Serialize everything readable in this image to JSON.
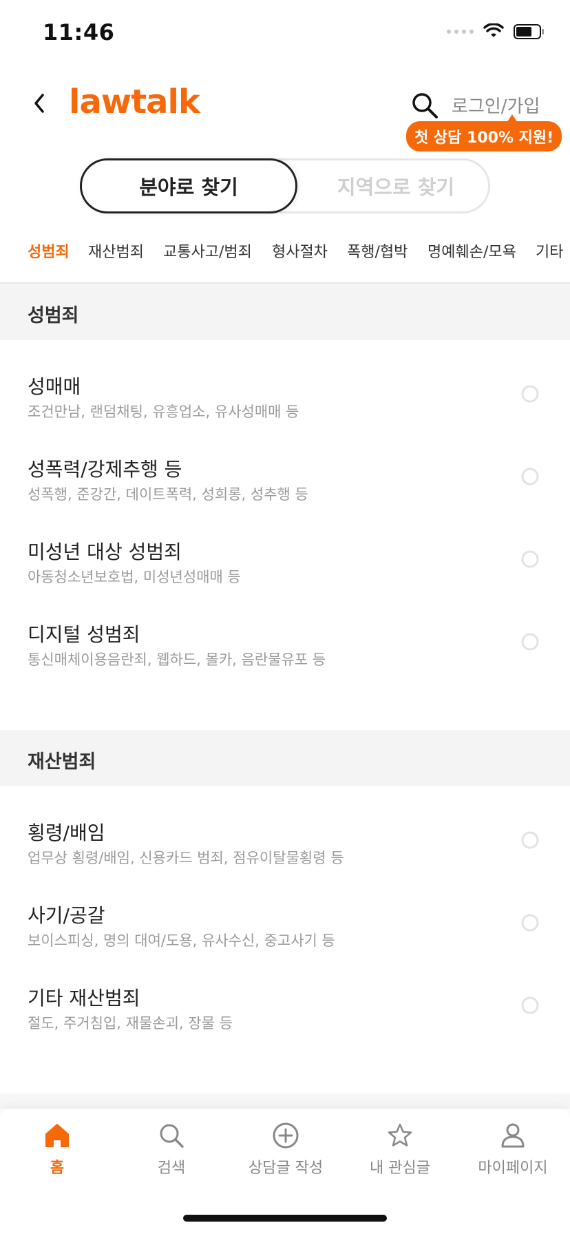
{
  "status_bar": {
    "time": "11:46"
  },
  "header": {
    "logo": "lawtalk",
    "login_label": "로그인/가입",
    "promo_badge": "첫 상담 100% 지원!"
  },
  "segment": {
    "active_label": "분야로 찾기",
    "inactive_label": "지역으로 찾기"
  },
  "category_tabs": [
    {
      "label": "성범죄",
      "active": true
    },
    {
      "label": "재산범죄"
    },
    {
      "label": "교통사고/범죄"
    },
    {
      "label": "형사절차"
    },
    {
      "label": "폭행/협박"
    },
    {
      "label": "명예훼손/모욕"
    },
    {
      "label": "기타"
    }
  ],
  "sections": [
    {
      "title": "성범죄",
      "items": [
        {
          "title": "성매매",
          "desc": "조건만남, 랜덤채팅, 유흥업소, 유사성매매 등"
        },
        {
          "title": "성폭력/강제추행 등",
          "desc": "성폭행, 준강간, 데이트폭력, 성희롱, 성추행 등"
        },
        {
          "title": "미성년 대상 성범죄",
          "desc": "아동청소년보호법, 미성년성매매 등"
        },
        {
          "title": "디지털 성범죄",
          "desc": "통신매체이용음란죄, 웹하드, 몰카, 음란물유포 등"
        }
      ]
    },
    {
      "title": "재산범죄",
      "items": [
        {
          "title": "횡령/배임",
          "desc": "업무상 횡령/배임, 신용카드 범죄, 점유이탈물횡령 등"
        },
        {
          "title": "사기/공갈",
          "desc": "보이스피싱, 명의 대여/도용, 유사수신, 중고사기 등"
        },
        {
          "title": "기타 재산범죄",
          "desc": "절도, 주거침입, 재물손괴, 장물 등"
        }
      ]
    }
  ],
  "bottom_nav": [
    {
      "label": "홈",
      "icon": "home-icon",
      "active": true
    },
    {
      "label": "검색",
      "icon": "search-icon"
    },
    {
      "label": "상담글 작성",
      "icon": "plus-circle-icon"
    },
    {
      "label": "내 관심글",
      "icon": "star-icon"
    },
    {
      "label": "마이페이지",
      "icon": "user-icon"
    }
  ],
  "colors": {
    "accent": "#f5690a",
    "text": "#222222",
    "muted": "#9a9a9a",
    "section_bg": "#f4f4f4"
  }
}
